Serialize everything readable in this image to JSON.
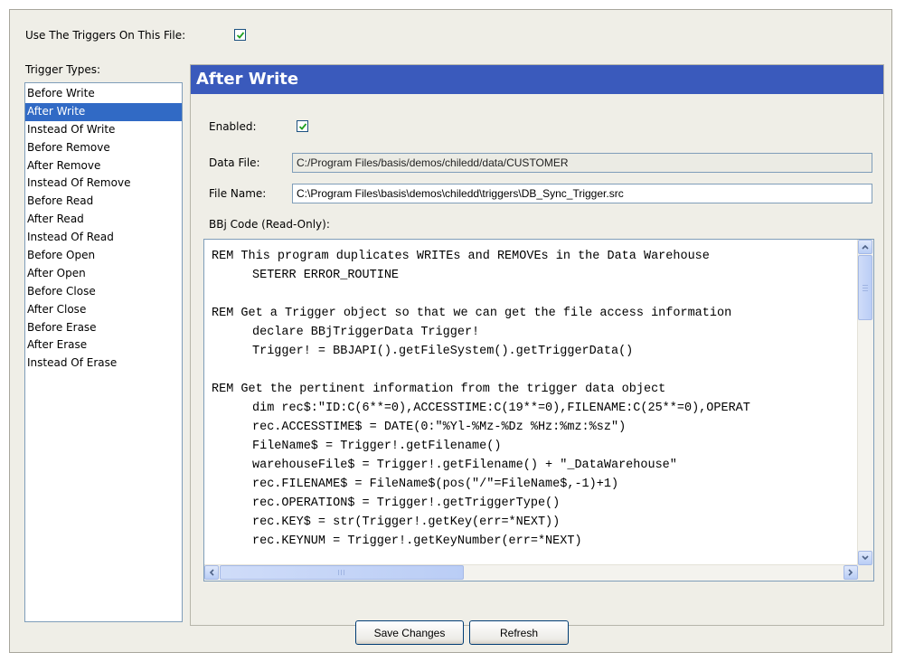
{
  "use_triggers": {
    "label": "Use The Triggers On This File:",
    "checked": true
  },
  "trigger_types": {
    "label": "Trigger Types:",
    "selected_index": 1,
    "items": [
      "Before Write",
      "After Write",
      "Instead Of Write",
      "Before Remove",
      "After Remove",
      "Instead Of Remove",
      "Before Read",
      "After Read",
      "Instead Of Read",
      "Before Open",
      "After Open",
      "Before Close",
      "After Close",
      "Before Erase",
      "After Erase",
      "Instead Of Erase"
    ]
  },
  "panel": {
    "title": "After Write",
    "enabled": {
      "label": "Enabled:",
      "checked": true
    },
    "data_file": {
      "label": "Data File:",
      "value": "C:/Program Files/basis/demos/chiledd/data/CUSTOMER"
    },
    "file_name": {
      "label": "File Name:",
      "value": "C:\\Program Files\\basis\\demos\\chiledd\\triggers\\DB_Sync_Trigger.src"
    },
    "code_label": "BBj Code (Read-Only):",
    "code_lines": [
      {
        "text": "REM This program duplicates WRITEs and REMOVEs in the Data Warehouse",
        "indent": false
      },
      {
        "text": "SETERR ERROR_ROUTINE",
        "indent": true
      },
      {
        "text": "",
        "indent": false
      },
      {
        "text": "REM Get a Trigger object so that we can get the file access information",
        "indent": false
      },
      {
        "text": "declare BBjTriggerData Trigger!",
        "indent": true
      },
      {
        "text": "Trigger! = BBJAPI().getFileSystem().getTriggerData()",
        "indent": true
      },
      {
        "text": "",
        "indent": false
      },
      {
        "text": "REM Get the pertinent information from the trigger data object",
        "indent": false
      },
      {
        "text": "dim rec$:\"ID:C(6**=0),ACCESSTIME:C(19**=0),FILENAME:C(25**=0),OPERAT",
        "indent": true
      },
      {
        "text": "rec.ACCESSTIME$ = DATE(0:\"%Yl-%Mz-%Dz %Hz:%mz:%sz\")",
        "indent": true
      },
      {
        "text": "FileName$ = Trigger!.getFilename()",
        "indent": true
      },
      {
        "text": "warehouseFile$ = Trigger!.getFilename() + \"_DataWarehouse\"",
        "indent": true
      },
      {
        "text": "rec.FILENAME$ = FileName$(pos(\"/\"=FileName$,-1)+1)",
        "indent": true
      },
      {
        "text": "rec.OPERATION$ = Trigger!.getTriggerType()",
        "indent": true
      },
      {
        "text": "rec.KEY$ = str(Trigger!.getKey(err=*NEXT))",
        "indent": true
      },
      {
        "text": "rec.KEYNUM = Trigger!.getKeyNumber(err=*NEXT)",
        "indent": true
      }
    ]
  },
  "buttons": {
    "save": "Save Changes",
    "refresh": "Refresh"
  },
  "icons": {
    "checkbox_check": "check-icon",
    "scroll_up": "arrow-up-icon",
    "scroll_down": "arrow-down-icon",
    "scroll_left": "arrow-left-icon",
    "scroll_right": "arrow-right-icon"
  },
  "colors": {
    "header_bg": "#3a5abc",
    "selection_bg": "#316ac5",
    "check_color": "#21a121"
  }
}
